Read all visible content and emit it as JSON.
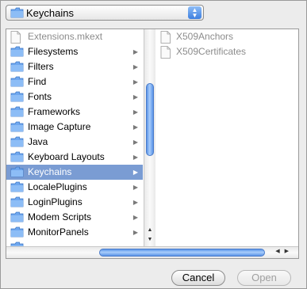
{
  "path_popup": {
    "label": "Keychains",
    "icon": "folder-icon",
    "arrows": "▲▼"
  },
  "column1": {
    "items": [
      {
        "label": "Extensions.mkext",
        "icon": "document-icon",
        "folder": false,
        "dim": true,
        "selected": false
      },
      {
        "label": "Filesystems",
        "icon": "folder-icon",
        "folder": true,
        "dim": false,
        "selected": false
      },
      {
        "label": "Filters",
        "icon": "folder-icon",
        "folder": true,
        "dim": false,
        "selected": false
      },
      {
        "label": "Find",
        "icon": "folder-icon",
        "folder": true,
        "dim": false,
        "selected": false
      },
      {
        "label": "Fonts",
        "icon": "folder-icon",
        "folder": true,
        "dim": false,
        "selected": false
      },
      {
        "label": "Frameworks",
        "icon": "folder-icon",
        "folder": true,
        "dim": false,
        "selected": false
      },
      {
        "label": "Image Capture",
        "icon": "folder-icon",
        "folder": true,
        "dim": false,
        "selected": false
      },
      {
        "label": "Java",
        "icon": "folder-icon",
        "folder": true,
        "dim": false,
        "selected": false
      },
      {
        "label": "Keyboard Layouts",
        "icon": "folder-icon",
        "folder": true,
        "dim": false,
        "selected": false
      },
      {
        "label": "Keychains",
        "icon": "folder-icon",
        "folder": true,
        "dim": false,
        "selected": true
      },
      {
        "label": "LocalePlugins",
        "icon": "folder-icon",
        "folder": true,
        "dim": false,
        "selected": false
      },
      {
        "label": "LoginPlugins",
        "icon": "folder-icon",
        "folder": true,
        "dim": false,
        "selected": false
      },
      {
        "label": "Modem Scripts",
        "icon": "folder-icon",
        "folder": true,
        "dim": false,
        "selected": false
      },
      {
        "label": "MonitorPanels",
        "icon": "folder-icon",
        "folder": true,
        "dim": false,
        "selected": false
      }
    ],
    "partial_item": {
      "icon": "folder-icon"
    },
    "scroll_arrows": {
      "up": "▲",
      "down": "▼"
    }
  },
  "column2": {
    "items": [
      {
        "label": "X509Anchors",
        "icon": "document-icon"
      },
      {
        "label": "X509Certificates",
        "icon": "document-icon"
      }
    ]
  },
  "hscroll": {
    "left": "◀",
    "right": "▶"
  },
  "buttons": {
    "cancel": "Cancel",
    "open": "Open"
  },
  "colors": {
    "selection": "#7a9cd3",
    "folder": "#6fa7ee",
    "thumb": "#5a94e8"
  }
}
